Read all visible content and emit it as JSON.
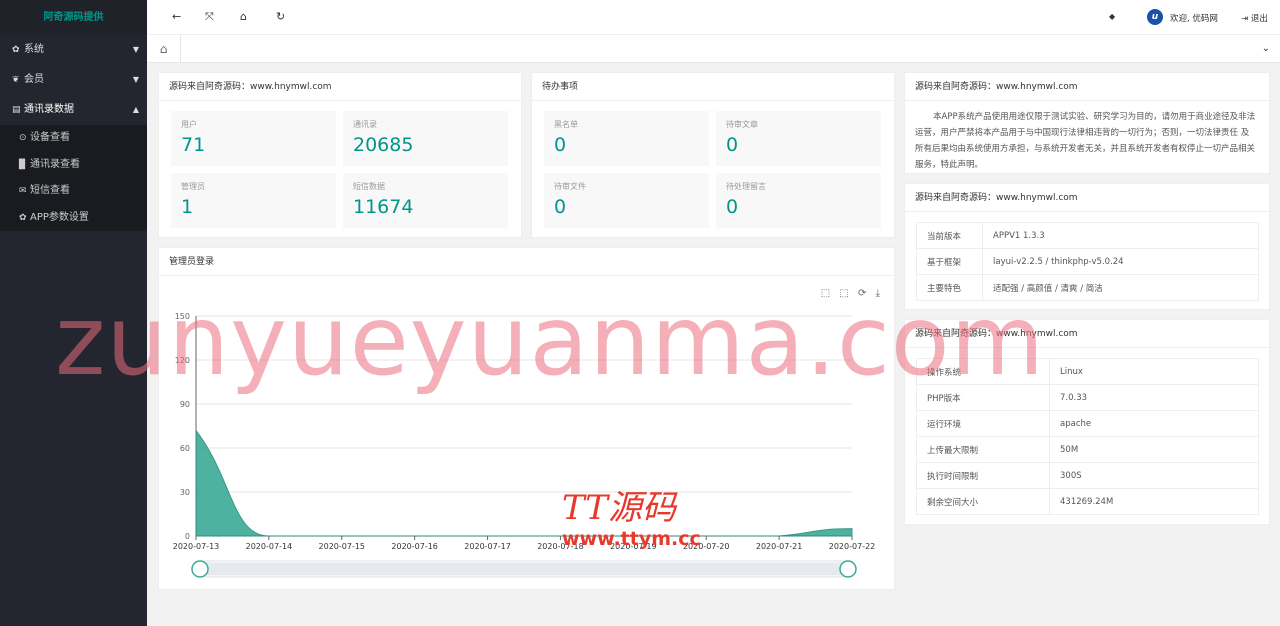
{
  "sidebar": {
    "logo": "阿奇源码提供",
    "menu": [
      {
        "label": "系统",
        "icon": "gear-icon",
        "glyph": "✿"
      },
      {
        "label": "会员",
        "icon": "users-icon",
        "glyph": "❦"
      },
      {
        "label": "通讯录数据",
        "icon": "card-icon",
        "glyph": "▤"
      }
    ],
    "submenu": [
      {
        "label": "设备查看",
        "icon": "lock-icon",
        "glyph": "⊙"
      },
      {
        "label": "通讯录查看",
        "icon": "book-icon",
        "glyph": "▉"
      },
      {
        "label": "短信查看",
        "icon": "envelope-icon",
        "glyph": "✉"
      },
      {
        "label": "APP参数设置",
        "icon": "gear-icon",
        "glyph": "✿"
      }
    ]
  },
  "header": {
    "back": "←",
    "fullscreen": "⤧",
    "home": "⌂",
    "refresh": "↻",
    "tag": "◆",
    "welcome": "欢迎, 优码网",
    "logout": "退出",
    "avatar": "u"
  },
  "tabs": {
    "home": "⌂",
    "dropdown": "⌄"
  },
  "stats1": {
    "title": "源码来自阿奇源码：www.hnymwl.com",
    "items": [
      {
        "label": "用户",
        "value": "71"
      },
      {
        "label": "通讯录",
        "value": "20685"
      },
      {
        "label": "管理员",
        "value": "1"
      },
      {
        "label": "短信数据",
        "value": "11674"
      }
    ]
  },
  "stats2": {
    "title": "待办事项",
    "items": [
      {
        "label": "黑名单",
        "value": "0"
      },
      {
        "label": "待审文章",
        "value": "0"
      },
      {
        "label": "待审文件",
        "value": "0"
      },
      {
        "label": "待处理留言",
        "value": "0"
      }
    ]
  },
  "chart_card": {
    "title": "管理员登录",
    "tools": [
      "⬚",
      "⬚",
      "⟳",
      "⤓"
    ]
  },
  "chart_data": {
    "type": "area",
    "x": [
      "2020-07-13",
      "2020-07-14",
      "2020-07-15",
      "2020-07-16",
      "2020-07-17",
      "2020-07-18",
      "2020-07-19",
      "2020-07-20",
      "2020-07-21",
      "2020-07-22"
    ],
    "values": [
      72,
      0,
      0,
      0,
      0,
      0,
      0,
      0,
      0,
      5
    ],
    "yticks": [
      0,
      30,
      60,
      90,
      120,
      150
    ],
    "ylim": [
      0,
      150
    ],
    "color": "#3aaa96"
  },
  "notice": {
    "title": "源码来自阿奇源码：www.hnymwl.com",
    "text": "本APP系统产品使用用途仅限于测试实验、研究学习为目的，请勿用于商业途径及非法运营，用户严禁将本产品用于与中国现行法律相违背的一切行为；否则，一切法律责任 及 所有后果均由系统使用方承担，与系统开发者无关，并且系统开发者有权停止一切产品相关服务，特此声明。"
  },
  "version": {
    "title": "源码来自阿奇源码：www.hnymwl.com",
    "rows": [
      {
        "k": "当前版本",
        "v": "APPV1 1.3.3"
      },
      {
        "k": "基于框架",
        "v": "layui-v2.2.5 / thinkphp-v5.0.24"
      },
      {
        "k": "主要特色",
        "v": "适配强 / 高颜值 / 清爽 / 简洁"
      }
    ]
  },
  "server": {
    "title": "源码来自阿奇源码：www.hnymwl.com",
    "rows": [
      {
        "k": "操作系统",
        "v": "Linux"
      },
      {
        "k": "PHP版本",
        "v": "7.0.33"
      },
      {
        "k": "运行环境",
        "v": "apache"
      },
      {
        "k": "上传最大限制",
        "v": "50M"
      },
      {
        "k": "执行时间限制",
        "v": "300S"
      },
      {
        "k": "剩余空间大小",
        "v": "431269.24M"
      }
    ]
  },
  "watermark": {
    "main": "zunyueyuanma.com",
    "brand": "TT源码",
    "url": "www.ttym.cc"
  }
}
